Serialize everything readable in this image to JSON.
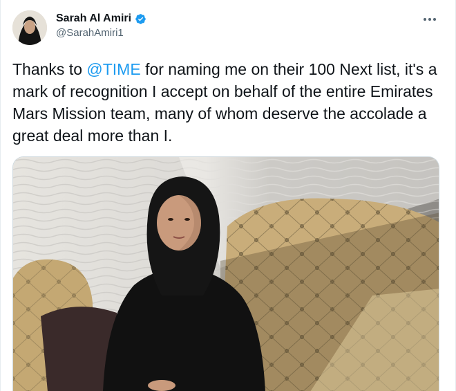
{
  "tweet": {
    "display_name": "Sarah Al Amiri",
    "handle": "@SarahAmiri1",
    "verified": true,
    "text_before": "Thanks to ",
    "mention": "@TIME",
    "text_after": " for naming me on their 100 Next list, it's a mark of recognition I accept on behalf of the entire Emirates Mars Mission team, many of whom deserve the accolade a great deal more than I."
  },
  "icons": {
    "verified": "verified-badge-icon",
    "more": "more-options-icon"
  },
  "colors": {
    "mention": "#1d9bf0",
    "verified": "#1d9bf0",
    "secondary_text": "#536471"
  }
}
